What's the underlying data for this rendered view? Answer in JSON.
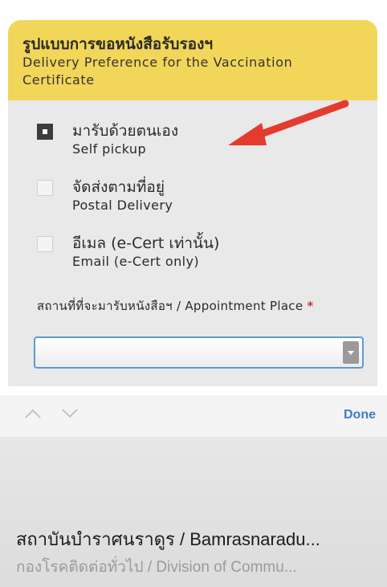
{
  "header": {
    "title_th": "รูปแบบการขอหนังสือรับรองฯ",
    "title_en": "Delivery Preference for the Vaccination Certificate"
  },
  "options": [
    {
      "label_th": "มารับด้วยตนเอง",
      "label_en": "Self pickup",
      "checked": true
    },
    {
      "label_th": "จัดส่งตามที่อยู่",
      "label_en": "Postal Delivery",
      "checked": false
    },
    {
      "label_th": "อีเมล (e-Cert เท่านั้น)",
      "label_en": "Email (e-Cert only)",
      "checked": false
    }
  ],
  "appointment": {
    "label": "สถานที่ที่จะมารับหนังสือฯ / Appointment Place",
    "required_mark": "*",
    "selected_value": ""
  },
  "toolbar": {
    "done_label": "Done"
  },
  "picker": {
    "selected": "สถาบันบำราศนราดูร / Bamrasnaradu...",
    "next": "กองโรคติดต่อทั่วไป / Division of Commu..."
  },
  "colors": {
    "header_bg": "#f2d659",
    "arrow": "#e53b2f",
    "select_border": "#5b9bd5",
    "done": "#3d7cc9"
  }
}
